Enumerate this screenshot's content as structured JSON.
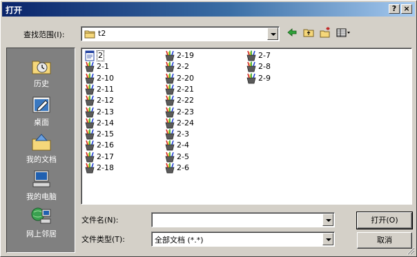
{
  "window": {
    "title": "打开",
    "help_btn": "?",
    "close_btn": "×"
  },
  "lookin": {
    "label": "查找范围(I):",
    "value": "t2"
  },
  "places": [
    {
      "label": "历史",
      "icon": "history-icon"
    },
    {
      "label": "桌面",
      "icon": "desktop-icon"
    },
    {
      "label": "我的文档",
      "icon": "my-documents-icon"
    },
    {
      "label": "我的电脑",
      "icon": "my-computer-icon"
    },
    {
      "label": "网上邻居",
      "icon": "network-places-icon"
    }
  ],
  "files": {
    "columns": [
      [
        {
          "name": "2",
          "icon": "document-icon",
          "selected": true
        },
        {
          "name": "2-1",
          "icon": "image-file-icon"
        },
        {
          "name": "2-10",
          "icon": "image-file-icon"
        },
        {
          "name": "2-11",
          "icon": "image-file-icon"
        },
        {
          "name": "2-12",
          "icon": "image-file-icon"
        },
        {
          "name": "2-13",
          "icon": "image-file-icon"
        },
        {
          "name": "2-14",
          "icon": "image-file-icon"
        },
        {
          "name": "2-15",
          "icon": "image-file-icon"
        },
        {
          "name": "2-16",
          "icon": "image-file-icon"
        },
        {
          "name": "2-17",
          "icon": "image-file-icon"
        },
        {
          "name": "2-18",
          "icon": "image-file-icon"
        }
      ],
      [
        {
          "name": "2-19",
          "icon": "image-file-icon"
        },
        {
          "name": "2-2",
          "icon": "image-file-icon"
        },
        {
          "name": "2-20",
          "icon": "image-file-icon"
        },
        {
          "name": "2-21",
          "icon": "image-file-icon"
        },
        {
          "name": "2-22",
          "icon": "image-file-icon"
        },
        {
          "name": "2-23",
          "icon": "image-file-icon"
        },
        {
          "name": "2-24",
          "icon": "image-file-icon"
        },
        {
          "name": "2-3",
          "icon": "image-file-icon"
        },
        {
          "name": "2-4",
          "icon": "image-file-icon"
        },
        {
          "name": "2-5",
          "icon": "image-file-icon"
        },
        {
          "name": "2-6",
          "icon": "image-file-icon"
        }
      ],
      [
        {
          "name": "2-7",
          "icon": "image-file-icon"
        },
        {
          "name": "2-8",
          "icon": "image-file-icon"
        },
        {
          "name": "2-9",
          "icon": "image-file-icon"
        }
      ]
    ]
  },
  "filename": {
    "label": "文件名(N):",
    "value": ""
  },
  "filetype": {
    "label": "文件类型(T):",
    "value": "全部文档 (*.*)"
  },
  "buttons": {
    "open": "打开(O)",
    "cancel": "取消"
  }
}
